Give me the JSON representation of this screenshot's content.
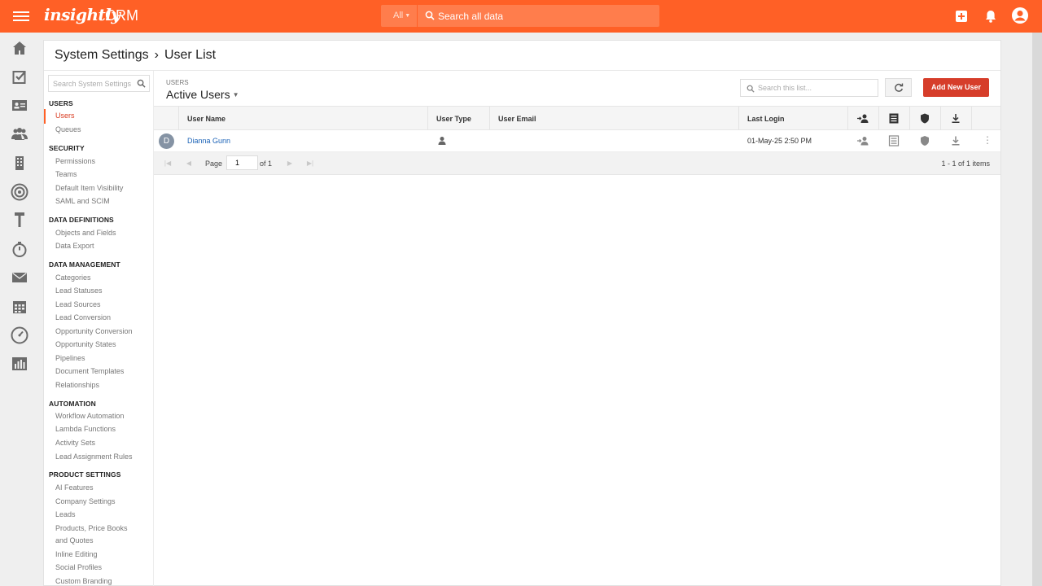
{
  "topbar": {
    "logo": "insightly",
    "logo_suffix": "CRM",
    "search_scope": "All",
    "search_placeholder": "Search all data"
  },
  "breadcrumb": {
    "parent": "System Settings",
    "separator": "›",
    "current": "User List"
  },
  "settings_search_placeholder": "Search System Settings",
  "sidebar": {
    "users": {
      "title": "USERS",
      "items": [
        "Users",
        "Queues"
      ]
    },
    "security": {
      "title": "SECURITY",
      "items": [
        "Permissions",
        "Teams",
        "Default Item Visibility",
        "SAML and SCIM"
      ]
    },
    "data_definitions": {
      "title": "DATA DEFINITIONS",
      "items": [
        "Objects and Fields",
        "Data Export"
      ]
    },
    "data_management": {
      "title": "DATA MANAGEMENT",
      "items": [
        "Categories",
        "Lead Statuses",
        "Lead Sources",
        "Lead Conversion",
        "Opportunity Conversion",
        "Opportunity States",
        "Pipelines",
        "Document Templates",
        "Relationships"
      ]
    },
    "automation": {
      "title": "AUTOMATION",
      "items": [
        "Workflow Automation",
        "Lambda Functions",
        "Activity Sets",
        "Lead Assignment Rules"
      ]
    },
    "product_settings": {
      "title": "PRODUCT SETTINGS",
      "items": [
        "AI Features",
        "Company Settings",
        "Leads",
        "Products, Price Books",
        "and Quotes",
        "Inline Editing",
        "Social Profiles",
        "Custom Branding"
      ]
    }
  },
  "users_panel": {
    "kicker": "USERS",
    "view": "Active Users",
    "search_placeholder": "Search this list...",
    "add_button": "Add New User"
  },
  "table": {
    "columns": [
      "User Name",
      "User Type",
      "User Email",
      "Last Login"
    ],
    "rows": [
      {
        "avatar": "D",
        "name": "Dianna Gunn",
        "email": "",
        "last_login": "01-May-25 2:50 PM"
      }
    ]
  },
  "pager": {
    "page_label": "Page",
    "page_value": "1",
    "of_label": "of 1",
    "summary": "1 - 1 of 1 items"
  },
  "colors": {
    "brand": "#ff6026",
    "primary_button": "#d63d2a",
    "link": "#1c63b7"
  }
}
